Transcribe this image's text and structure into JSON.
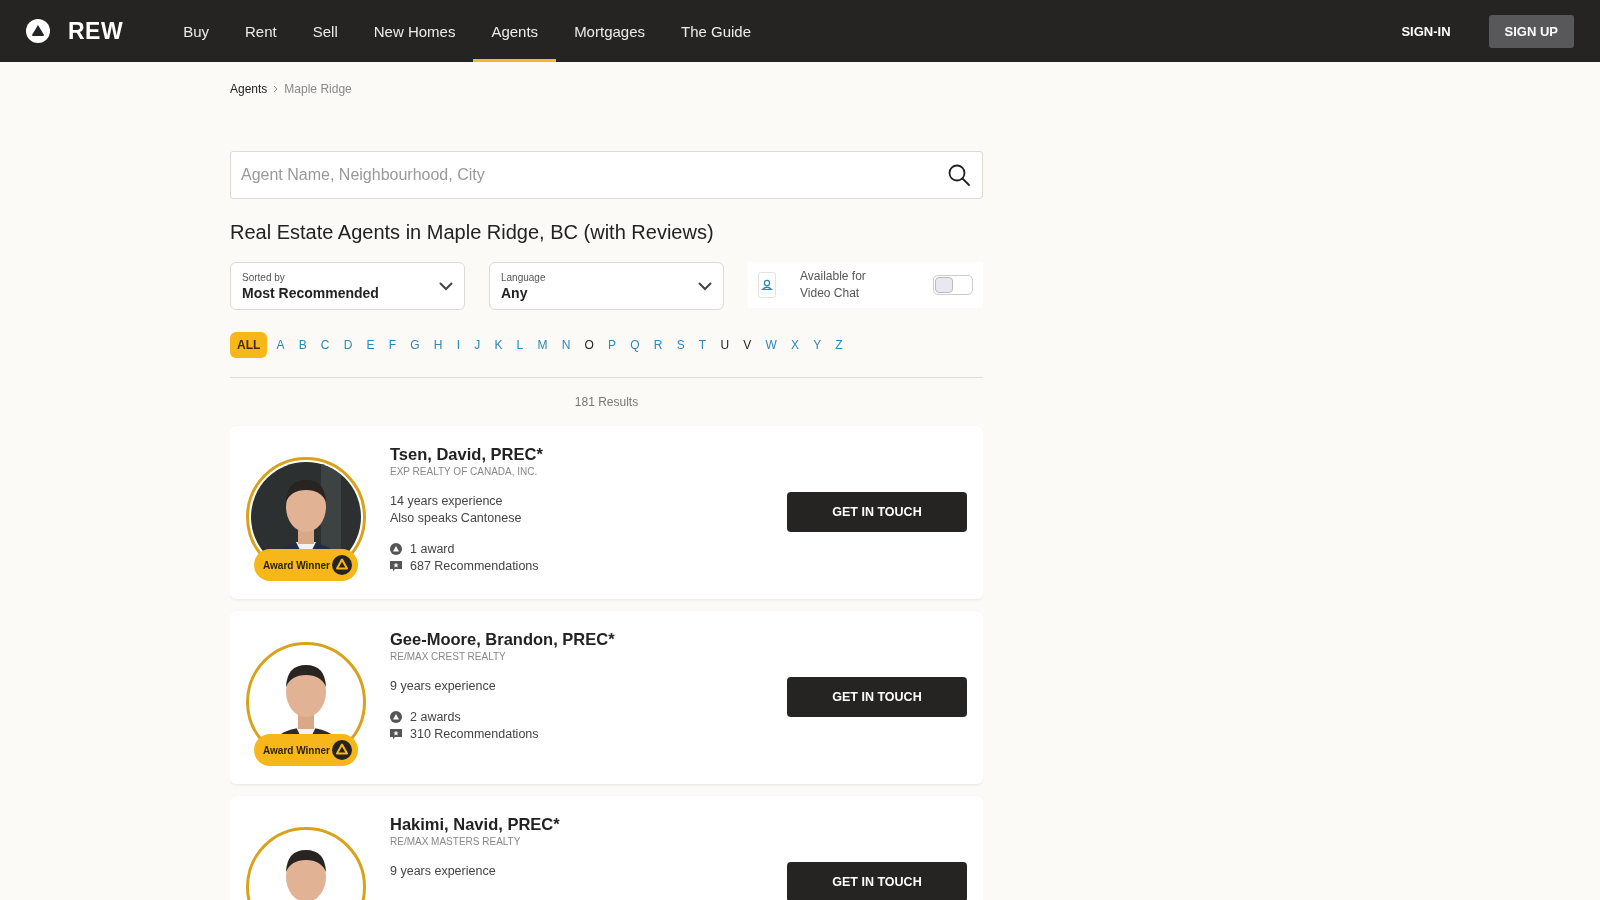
{
  "header": {
    "logo": "REW",
    "nav": [
      {
        "label": "Buy",
        "selected": false
      },
      {
        "label": "Rent",
        "selected": false
      },
      {
        "label": "Sell",
        "selected": false
      },
      {
        "label": "New Homes",
        "selected": false
      },
      {
        "label": "Agents",
        "selected": true
      },
      {
        "label": "Mortgages",
        "selected": false
      },
      {
        "label": "The Guide",
        "selected": false
      }
    ],
    "sign_in": "SIGN-IN",
    "sign_up": "SIGN UP"
  },
  "breadcrumb": [
    "Agents",
    "Maple Ridge"
  ],
  "search": {
    "placeholder": "Agent Name, Neighbourhood, City"
  },
  "heading": "Real Estate Agents in Maple Ridge, BC (with Reviews)",
  "filters": {
    "sort": {
      "label": "Sorted by",
      "value": "Most Recommended"
    },
    "language": {
      "label": "Language",
      "value": "Any"
    },
    "video_chat": {
      "label": "Available for Video Chat",
      "on": false
    }
  },
  "letters": [
    {
      "label": "ALL",
      "selected": true,
      "disabled": false
    },
    {
      "label": "A",
      "selected": false,
      "disabled": false
    },
    {
      "label": "B",
      "selected": false,
      "disabled": false
    },
    {
      "label": "C",
      "selected": false,
      "disabled": false
    },
    {
      "label": "D",
      "selected": false,
      "disabled": false
    },
    {
      "label": "E",
      "selected": false,
      "disabled": false
    },
    {
      "label": "F",
      "selected": false,
      "disabled": false
    },
    {
      "label": "G",
      "selected": false,
      "disabled": false
    },
    {
      "label": "H",
      "selected": false,
      "disabled": false
    },
    {
      "label": "I",
      "selected": false,
      "disabled": false
    },
    {
      "label": "J",
      "selected": false,
      "disabled": false
    },
    {
      "label": "K",
      "selected": false,
      "disabled": false
    },
    {
      "label": "L",
      "selected": false,
      "disabled": false
    },
    {
      "label": "M",
      "selected": false,
      "disabled": false
    },
    {
      "label": "N",
      "selected": false,
      "disabled": false
    },
    {
      "label": "O",
      "selected": false,
      "disabled": true
    },
    {
      "label": "P",
      "selected": false,
      "disabled": false
    },
    {
      "label": "Q",
      "selected": false,
      "disabled": false
    },
    {
      "label": "R",
      "selected": false,
      "disabled": false
    },
    {
      "label": "S",
      "selected": false,
      "disabled": false
    },
    {
      "label": "T",
      "selected": false,
      "disabled": false
    },
    {
      "label": "U",
      "selected": false,
      "disabled": true
    },
    {
      "label": "V",
      "selected": false,
      "disabled": true
    },
    {
      "label": "W",
      "selected": false,
      "disabled": false
    },
    {
      "label": "X",
      "selected": false,
      "disabled": false
    },
    {
      "label": "Y",
      "selected": false,
      "disabled": false
    },
    {
      "label": "Z",
      "selected": false,
      "disabled": false
    }
  ],
  "results_count": "181 Results",
  "agents": [
    {
      "name": "Tsen, David, PREC*",
      "brokerage": "EXP REALTY OF CANADA, INC.",
      "details": [
        "14 years experience",
        "Also speaks Cantonese"
      ],
      "badge": "Award Winner",
      "awards": "1 award",
      "recommendations": "687 Recommendations",
      "button": "GET IN TOUCH"
    },
    {
      "name": "Gee-Moore, Brandon, PREC*",
      "brokerage": "RE/MAX CREST REALTY",
      "details": [
        "9 years experience"
      ],
      "badge": "Award Winner",
      "awards": "2 awards",
      "recommendations": "310 Recommendations",
      "button": "GET IN TOUCH"
    },
    {
      "name": "Hakimi, Navid, PREC*",
      "brokerage": "RE/MAX MASTERS REALTY",
      "details": [
        "9 years experience"
      ],
      "button": "GET IN TOUCH"
    }
  ]
}
